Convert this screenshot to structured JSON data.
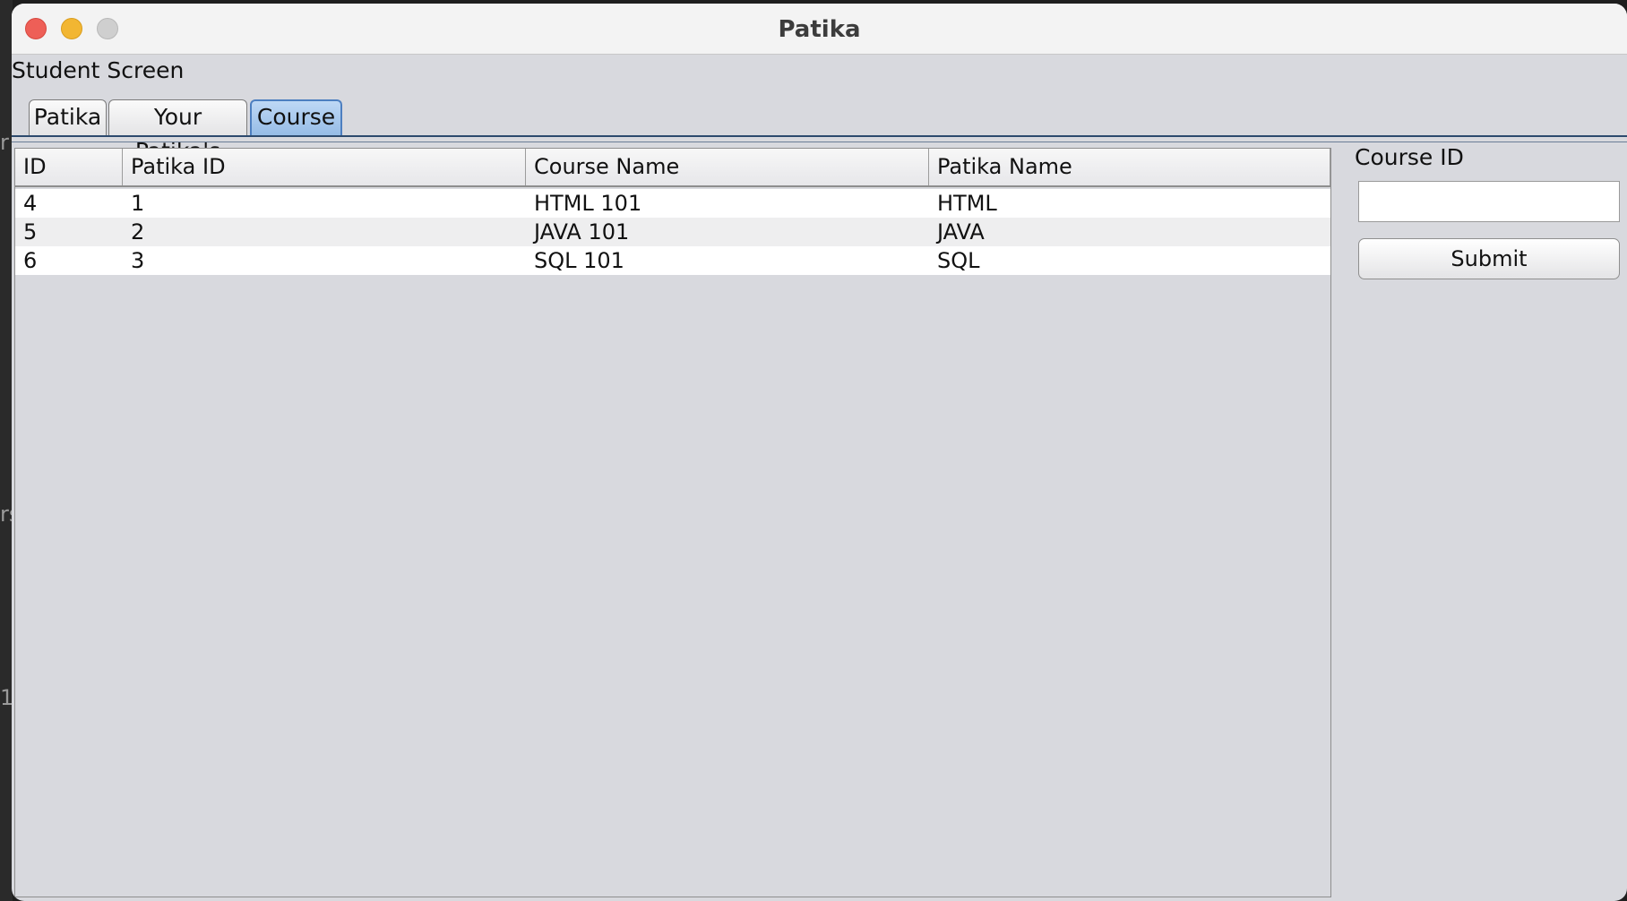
{
  "window": {
    "title": "Patika",
    "screen_label": "Student Screen"
  },
  "tabs": [
    {
      "label": "Patika",
      "active": false
    },
    {
      "label": "Your Patika's",
      "active": false
    },
    {
      "label": "Course",
      "active": true
    }
  ],
  "table": {
    "columns": [
      "ID",
      "Patika ID",
      "Course Name",
      "Patika Name"
    ],
    "rows": [
      [
        "4",
        "1",
        "HTML 101",
        "HTML"
      ],
      [
        "5",
        "2",
        "JAVA 101",
        "JAVA"
      ],
      [
        "6",
        "3",
        "SQL 101",
        "SQL"
      ]
    ]
  },
  "form": {
    "course_id_label": "Course ID",
    "course_id_value": "",
    "submit_label": "Submit"
  },
  "desktop_edge_glyphs": [
    "r",
    "rs",
    "1"
  ],
  "colors": {
    "close": "#ee5f57",
    "minimize": "#f2b632",
    "maximize": "#cfcfcf",
    "active_tab": "#96bce6",
    "window_bg": "#d8d9de"
  }
}
